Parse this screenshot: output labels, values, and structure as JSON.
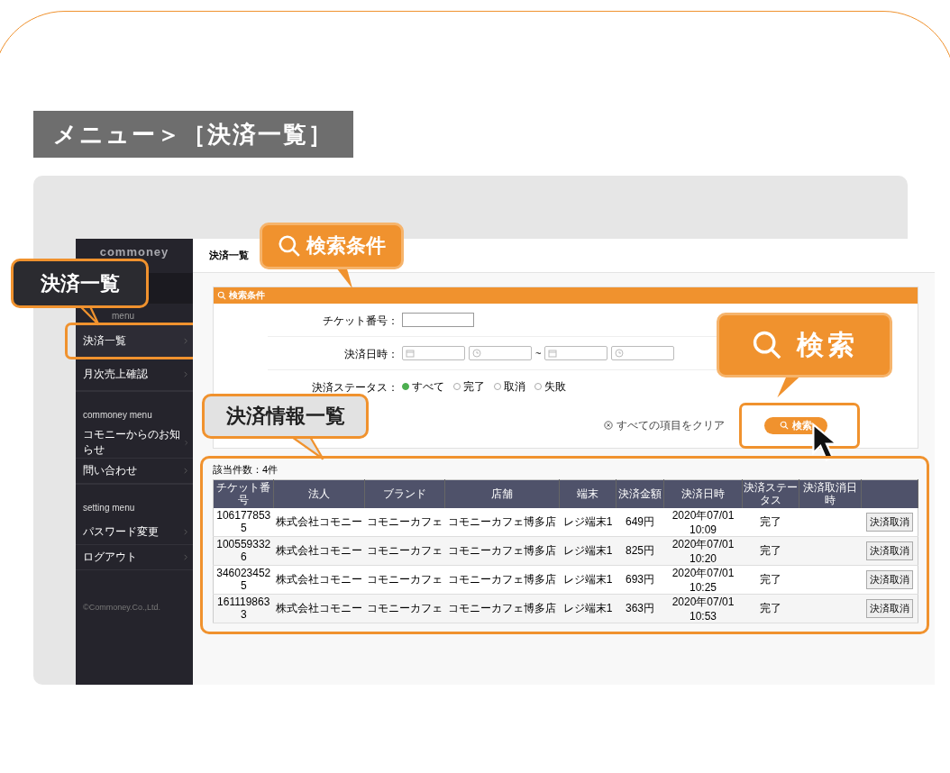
{
  "heading": "メニュー＞［決済一覧］",
  "sidebar": {
    "logo": "commoney",
    "section_label": "menu",
    "items": [
      {
        "label": "決済一覧",
        "selected": true
      },
      {
        "label": "月次売上確認",
        "selected": false
      }
    ],
    "groups": [
      {
        "title": "commoney menu",
        "items": [
          {
            "label": "コモニーからのお知らせ",
            "selected": false
          },
          {
            "label": "問い合わせ",
            "selected": false
          }
        ]
      },
      {
        "title": "setting menu",
        "items": [
          {
            "label": "パスワード変更",
            "selected": false
          },
          {
            "label": "ログアウト",
            "selected": false
          }
        ]
      }
    ],
    "copyright": "©Commoney.Co.,Ltd."
  },
  "page_title": "決済一覧",
  "search_panel": {
    "title": "検索条件",
    "ticket_label": "チケット番号：",
    "date_label": "決済日時：",
    "range_separator": "~",
    "status_label": "決済ステータス：",
    "status_options": [
      {
        "label": "すべて",
        "selected": true
      },
      {
        "label": "完了",
        "selected": false
      },
      {
        "label": "取消",
        "selected": false
      },
      {
        "label": "失敗",
        "selected": false
      }
    ],
    "clear_label": "すべての項目をクリア",
    "search_button": "検索"
  },
  "results": {
    "count": "該当件数：4件",
    "columns": [
      "チケット番号",
      "法人",
      "ブランド",
      "店舗",
      "端末",
      "決済金額",
      "決済日時",
      "決済ステータス",
      "決済取消日時"
    ],
    "rows": [
      {
        "cells": [
          "1061778535",
          "株式会社コモニー",
          "コモニーカフェ",
          "コモニーカフェ博多店",
          "レジ端末1",
          "649円",
          "2020年07/01 10:09",
          "完了",
          ""
        ],
        "action": "決済取消"
      },
      {
        "cells": [
          "1005593326",
          "株式会社コモニー",
          "コモニーカフェ",
          "コモニーカフェ博多店",
          "レジ端末1",
          "825円",
          "2020年07/01 10:20",
          "完了",
          ""
        ],
        "action": "決済取消"
      },
      {
        "cells": [
          "3460234525",
          "株式会社コモニー",
          "コモニーカフェ",
          "コモニーカフェ博多店",
          "レジ端末1",
          "693円",
          "2020年07/01 10:25",
          "完了",
          ""
        ],
        "action": "決済取消"
      },
      {
        "cells": [
          "1611198633",
          "株式会社コモニー",
          "コモニーカフェ",
          "コモニーカフェ博多店",
          "レジ端末1",
          "363円",
          "2020年07/01 10:53",
          "完了",
          ""
        ],
        "action": "決済取消"
      }
    ]
  },
  "callouts": {
    "menu": "決済一覧",
    "search_conditions": "検索条件",
    "search": "検索",
    "results": "決済情報一覧"
  }
}
